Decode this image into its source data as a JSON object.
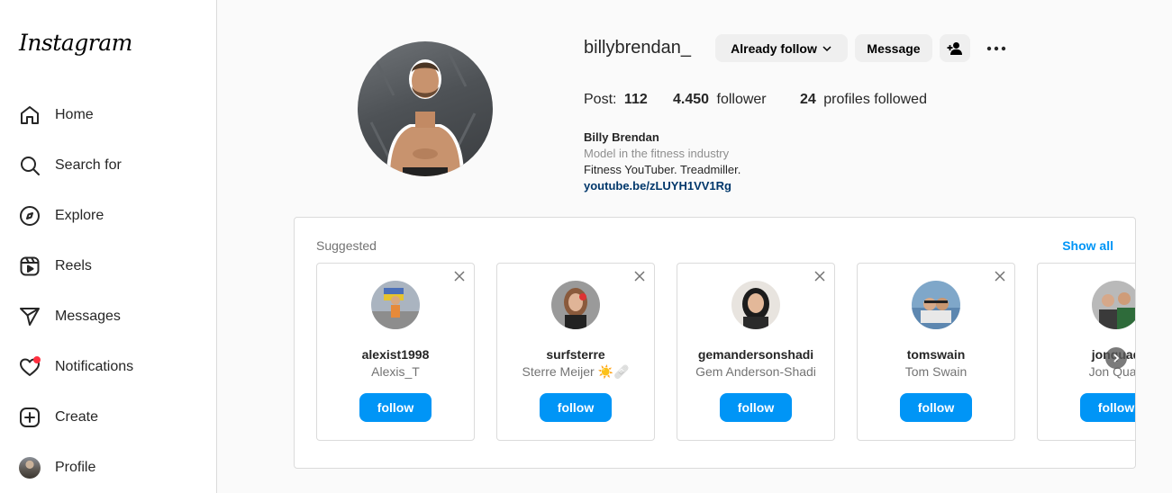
{
  "app": {
    "logo_text": "Instagram"
  },
  "sidebar": {
    "items": [
      {
        "label": "Home",
        "icon": "home-icon"
      },
      {
        "label": "Search for",
        "icon": "search-icon"
      },
      {
        "label": "Explore",
        "icon": "compass-icon"
      },
      {
        "label": "Reels",
        "icon": "reels-icon"
      },
      {
        "label": "Messages",
        "icon": "paper-plane-icon"
      },
      {
        "label": "Notifications",
        "icon": "heart-icon"
      },
      {
        "label": "Create",
        "icon": "plus-square-icon"
      },
      {
        "label": "Profile",
        "icon": "profile-avatar"
      }
    ],
    "notification_dot_color": "#ff3040"
  },
  "profile": {
    "username": "billybrendan_",
    "following_button": "Already follow",
    "message_button": "Message",
    "stats": {
      "posts_label": "Post:",
      "posts_value": "112",
      "followers_value": "4.450",
      "followers_label": "follower",
      "following_value": "24",
      "following_label": "profiles followed"
    },
    "bio": {
      "name": "Billy Brendan",
      "category": "Model in the fitness industry",
      "text": "Fitness YouTuber. Treadmiller.",
      "link": "youtube.be/zLUYH1VV1Rg"
    }
  },
  "suggested": {
    "title": "Suggested",
    "show_all": "Show all",
    "accounts": [
      {
        "handle": "alexist1998",
        "name": "Alexis_T",
        "follow": "follow"
      },
      {
        "handle": "surfsterre",
        "name": "Sterre Meijer ☀️🩹",
        "follow": "follow"
      },
      {
        "handle": "gemandersonshadi",
        "name": "Gem Anderson-Shadi",
        "follow": "follow"
      },
      {
        "handle": "tomswain",
        "name": "Tom Swain",
        "follow": "follow"
      },
      {
        "handle": "jonquad",
        "name": "Jon Quad",
        "follow": "follow"
      }
    ]
  },
  "colors": {
    "accent": "#0095f6",
    "link": "#00376b",
    "button_gray": "#efefef"
  }
}
